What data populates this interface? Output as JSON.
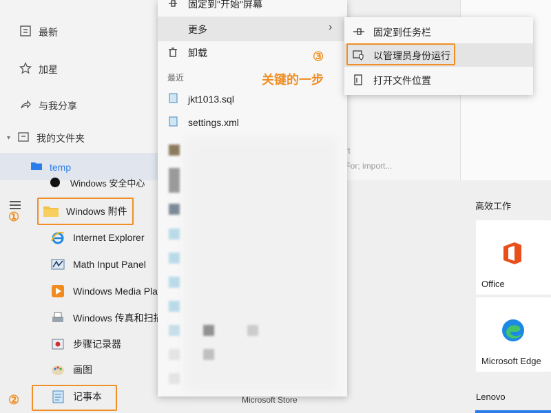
{
  "explorer": {
    "nav": [
      {
        "label": "最新",
        "icon": "recent-icon"
      },
      {
        "label": "加星",
        "icon": "star-icon"
      },
      {
        "label": "与我分享",
        "icon": "share-icon"
      },
      {
        "label": "我的文件夹",
        "icon": "folder-outline-icon"
      },
      {
        "label": "temp",
        "icon": "folder-icon"
      }
    ],
    "preview_lines": [
      "port",
      "heFor; import..."
    ]
  },
  "start_menu": {
    "apps": [
      {
        "label": "Windows 安全中心",
        "icon": "shield-icon"
      },
      {
        "label": "Windows 附件",
        "icon": "folder-icon"
      },
      {
        "label": "Internet Explorer",
        "icon": "ie-icon"
      },
      {
        "label": "Math Input Panel",
        "icon": "math-input-icon"
      },
      {
        "label": "Windows Media Pla",
        "icon": "media-player-icon"
      },
      {
        "label": "Windows 传真和扫描",
        "icon": "fax-scan-icon"
      },
      {
        "label": "步骤记录器",
        "icon": "steps-recorder-icon"
      },
      {
        "label": "画图",
        "icon": "paint-icon"
      },
      {
        "label": "记事本",
        "icon": "notepad-icon"
      }
    ],
    "group_title": "高效工作",
    "tiles": [
      {
        "label": "Office",
        "icon": "office-icon"
      },
      {
        "label": "Microsoft Edge",
        "icon": "edge-icon"
      }
    ],
    "bottom_label": "Lenovo",
    "store_label": "Microsoft Store"
  },
  "context_menu": {
    "pin_start": "固定到\"开始\"屏幕",
    "more": "更多",
    "uninstall": "卸载",
    "recent_header": "最近",
    "recent_files": [
      "jkt1013.sql",
      "settings.xml"
    ]
  },
  "submenu": {
    "items": [
      {
        "label": "固定到任务栏",
        "icon": "pin-icon"
      },
      {
        "label": "以管理员身份运行",
        "icon": "admin-shield-icon"
      },
      {
        "label": "打开文件位置",
        "icon": "file-location-icon"
      }
    ]
  },
  "annotations": {
    "step1": "①",
    "step2": "②",
    "step3": "③",
    "key_step": "关键的一步"
  },
  "colors": {
    "accent_orange": "#f08f25",
    "folder_yellow": "#f5c242",
    "link_blue": "#2b7de9"
  }
}
